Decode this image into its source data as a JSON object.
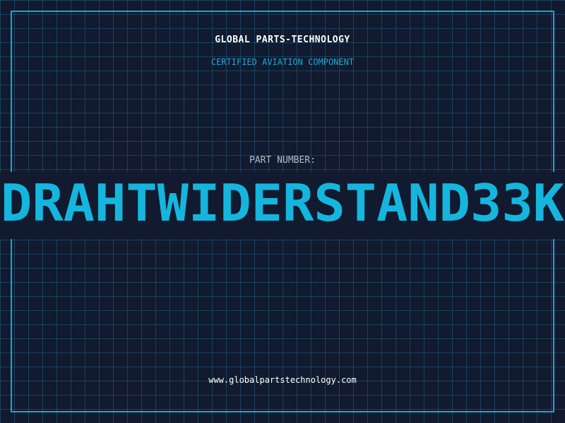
{
  "brand": {
    "company_name": "GLOBAL PARTS-TECHNOLOGY",
    "certification": "CERTIFIED AVIATION COMPONENT"
  },
  "part": {
    "label": "PART NUMBER:",
    "number": "DRAHTWIDERSTAND33K"
  },
  "footer": {
    "website": "www.globalpartstechnology.com"
  },
  "colors": {
    "background": "#111a2e",
    "grid": "#2382aa",
    "accent": "#15b6de",
    "border": "#18a8cf"
  }
}
